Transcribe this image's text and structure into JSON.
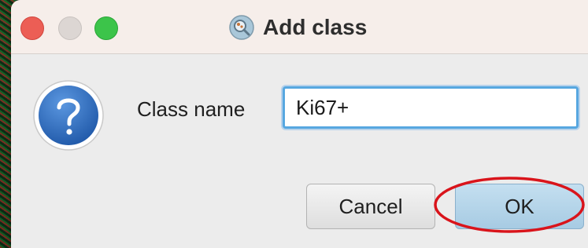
{
  "window": {
    "title": "Add class",
    "title_icon": "qupath-logo-icon"
  },
  "traffic_lights": [
    "close",
    "minimize",
    "zoom"
  ],
  "content": {
    "icon": "question-icon",
    "field_label": "Class name",
    "class_name_value": "Ki67+"
  },
  "buttons": {
    "cancel_label": "Cancel",
    "ok_label": "OK"
  },
  "colors": {
    "annotation_circle": "#d9141b",
    "input_focus": "#57a7e0",
    "default_button": "#b3d4ea",
    "question_icon": "#2f6ec0"
  }
}
